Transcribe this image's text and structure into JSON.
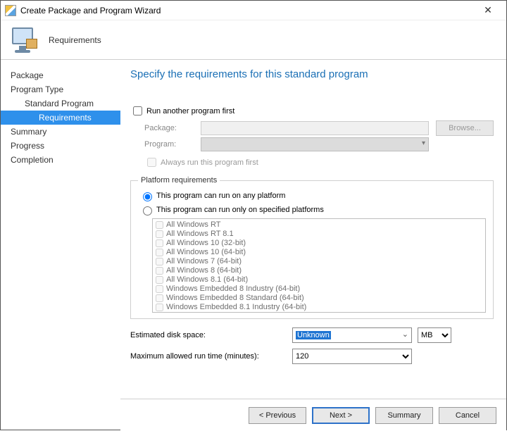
{
  "window": {
    "title": "Create Package and Program Wizard"
  },
  "header": {
    "section": "Requirements"
  },
  "nav": {
    "items": [
      {
        "label": "Package",
        "level": 1
      },
      {
        "label": "Program Type",
        "level": 1
      },
      {
        "label": "Standard Program",
        "level": 2
      },
      {
        "label": "Requirements",
        "level": 3,
        "selected": true
      },
      {
        "label": "Summary",
        "level": 1
      },
      {
        "label": "Progress",
        "level": 1
      },
      {
        "label": "Completion",
        "level": 1
      }
    ]
  },
  "page": {
    "heading": "Specify the requirements for this standard program",
    "run_first": {
      "checkbox_label": "Run another program first",
      "checked": false,
      "package_label": "Package:",
      "package_value": "",
      "browse_label": "Browse...",
      "program_label": "Program:",
      "always_run_label": "Always run this program first",
      "always_run_checked": false
    },
    "platform": {
      "legend": "Platform requirements",
      "radio_any": "This program can run on any platform",
      "radio_specified": "This program can run only on specified platforms",
      "selected": "any",
      "platforms": [
        "All Windows RT",
        "All Windows RT 8.1",
        "All Windows 10 (32-bit)",
        "All Windows 10 (64-bit)",
        "All Windows 7 (64-bit)",
        "All Windows 8 (64-bit)",
        "All Windows 8.1 (64-bit)",
        "Windows Embedded 8 Industry (64-bit)",
        "Windows Embedded 8 Standard (64-bit)",
        "Windows Embedded 8.1 Industry (64-bit)"
      ]
    },
    "disk": {
      "label": "Estimated disk space:",
      "value": "Unknown",
      "unit": "MB"
    },
    "runtime": {
      "label": "Maximum allowed run time (minutes):",
      "value": "120"
    }
  },
  "footer": {
    "previous": "< Previous",
    "next": "Next >",
    "summary": "Summary",
    "cancel": "Cancel"
  }
}
